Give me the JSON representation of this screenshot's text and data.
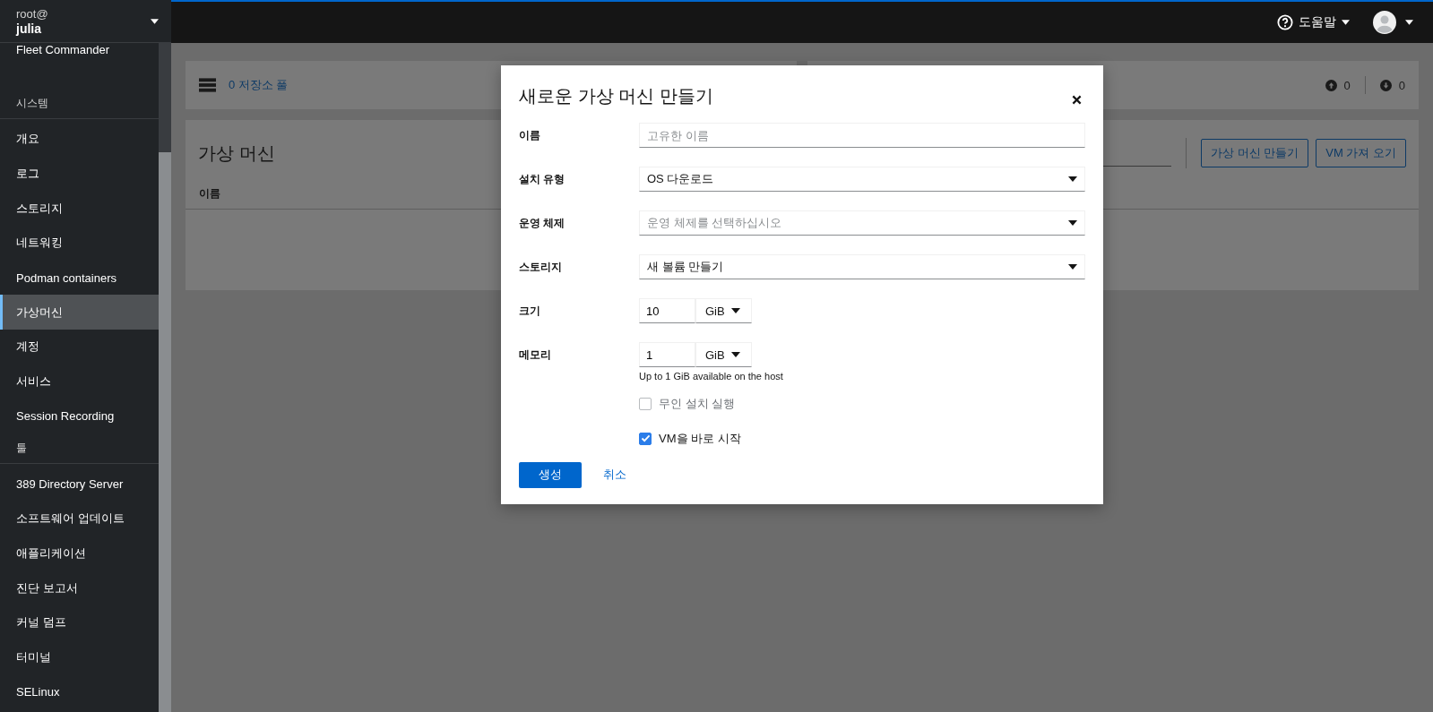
{
  "host": {
    "user": "root@",
    "name": "julia"
  },
  "sidebar": {
    "sections": [
      {
        "items": [
          {
            "label": "Fleet Commander",
            "selected": false
          }
        ]
      },
      {
        "heading": "시스템",
        "items": [
          {
            "label": "개요",
            "selected": false
          },
          {
            "label": "로그",
            "selected": false
          },
          {
            "label": "스토리지",
            "selected": false
          },
          {
            "label": "네트워킹",
            "selected": false
          },
          {
            "label": "Podman containers",
            "selected": false
          },
          {
            "label": "가상머신",
            "selected": true
          },
          {
            "label": "계정",
            "selected": false
          },
          {
            "label": "서비스",
            "selected": false
          },
          {
            "label": "Session Recording",
            "selected": false
          }
        ]
      },
      {
        "heading": "툴",
        "items": [
          {
            "label": "389 Directory Server",
            "selected": false
          },
          {
            "label": "소프트웨어 업데이트",
            "selected": false
          },
          {
            "label": "애플리케이션",
            "selected": false
          },
          {
            "label": "진단 보고서",
            "selected": false
          },
          {
            "label": "커널 덤프",
            "selected": false
          },
          {
            "label": "터미널",
            "selected": false
          },
          {
            "label": "SELinux",
            "selected": false
          }
        ]
      }
    ]
  },
  "topbar": {
    "help": "도움말"
  },
  "storage_card": {
    "label": "0 저장소 풀"
  },
  "network_card": {
    "up": "0",
    "down": "0"
  },
  "vm_card": {
    "title": "가상 머신",
    "buttons": [
      "가상 머신 만들기",
      "VM 가져 오기"
    ],
    "columns": [
      "이름"
    ]
  },
  "dialog": {
    "title": "새로운 가상 머신 만들기",
    "fields": [
      {
        "kind": "text",
        "label": "이름",
        "placeholder": "고유한 이름"
      },
      {
        "kind": "select",
        "label": "설치 유형",
        "value": "OS 다운로드"
      },
      {
        "kind": "select",
        "label": "운영 체제",
        "placeholder": "운영 체제를 선택하십시오"
      },
      {
        "kind": "select",
        "label": "스토리지",
        "value": "새 볼륨 만들기"
      },
      {
        "kind": "unit",
        "label": "크기",
        "value": "10",
        "unit": "GiB"
      },
      {
        "kind": "unit",
        "label": "메모리",
        "value": "1",
        "unit": "GiB",
        "helper": "Up to 1 GiB available on the host"
      }
    ],
    "checkboxes": [
      {
        "label": "무인 설치 실행",
        "checked": false,
        "disabled": true
      },
      {
        "label": "VM을 바로 시작",
        "checked": true,
        "disabled": false
      }
    ],
    "primary": "생성",
    "cancel": "취소"
  }
}
